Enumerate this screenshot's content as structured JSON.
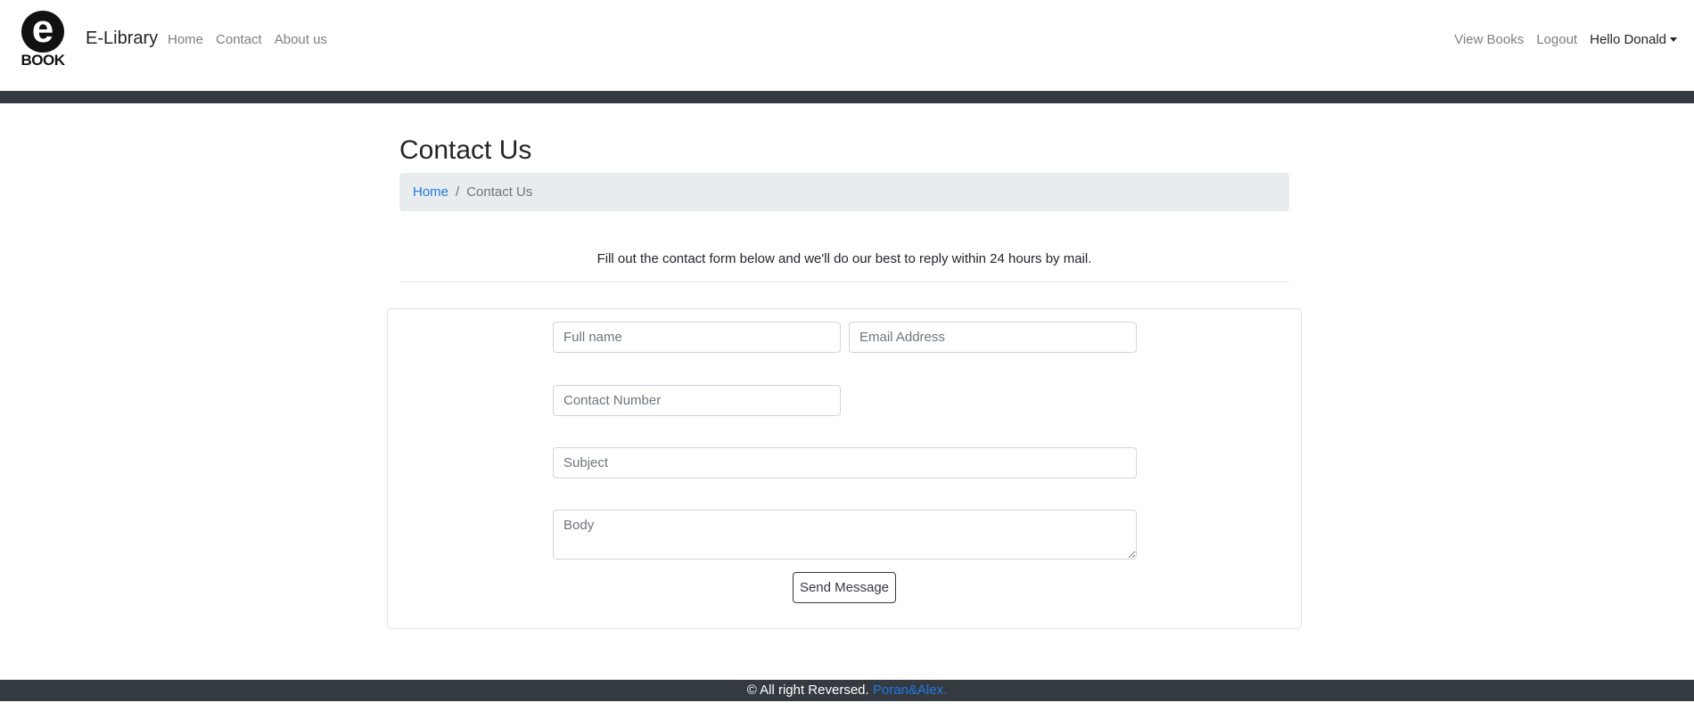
{
  "navbar": {
    "logo_letter": "e",
    "logo_text": "BOOK",
    "brand": "E-Library",
    "left_links": [
      "Home",
      "Contact",
      "About us"
    ],
    "right_links": [
      "View Books",
      "Logout"
    ],
    "user_greeting": "Hello Donald"
  },
  "page": {
    "title": "Contact Us",
    "breadcrumb": {
      "home": "Home",
      "separator": "/",
      "current": "Contact Us"
    },
    "lead": "Fill out the contact form below and we'll do our best to reply within 24 hours by mail."
  },
  "form": {
    "full_name_placeholder": "Full name",
    "email_placeholder": "Email Address",
    "contact_placeholder": "Contact Number",
    "subject_placeholder": "Subject",
    "body_placeholder": "Body",
    "submit_label": "Send Message"
  },
  "footer": {
    "text": "© All right Reversed.",
    "link": "Poran&Alex."
  },
  "colors": {
    "navbar_strip": "#343a40",
    "breadcrumb_bg": "#e9ecef",
    "link": "#1e7be6"
  }
}
